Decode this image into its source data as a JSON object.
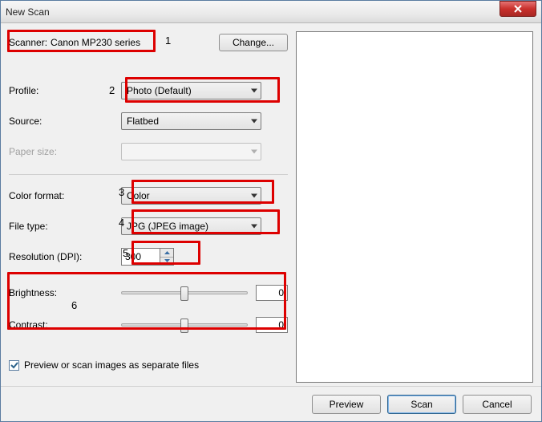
{
  "window": {
    "title": "New Scan"
  },
  "scanner": {
    "label": "Scanner:",
    "value": "Canon MP230 series",
    "change_btn": "Change..."
  },
  "profile": {
    "label": "Profile:",
    "value": "Photo (Default)"
  },
  "source": {
    "label": "Source:",
    "value": "Flatbed"
  },
  "papersize": {
    "label": "Paper size:",
    "value": ""
  },
  "colorformat": {
    "label": "Color format:",
    "value": "Color"
  },
  "filetype": {
    "label": "File type:",
    "value": "JPG (JPEG image)"
  },
  "resolution": {
    "label": "Resolution (DPI):",
    "value": "300"
  },
  "brightness": {
    "label": "Brightness:",
    "value": "0"
  },
  "contrast": {
    "label": "Contrast:",
    "value": "0"
  },
  "separate": {
    "label": "Preview or scan images as separate files",
    "checked": true
  },
  "buttons": {
    "preview": "Preview",
    "scan": "Scan",
    "cancel": "Cancel"
  },
  "annotations": {
    "n1": "1",
    "n2": "2",
    "n3": "3",
    "n4": "4",
    "n5": "5",
    "n6": "6"
  }
}
